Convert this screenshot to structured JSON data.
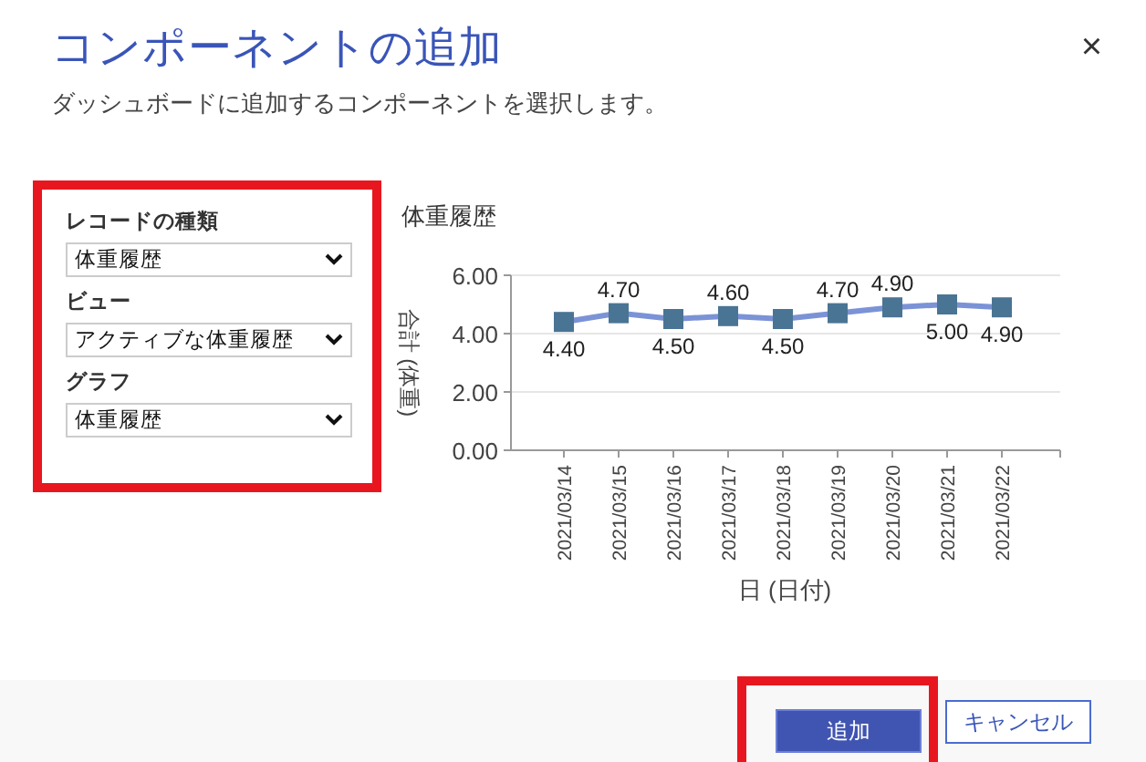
{
  "dialog": {
    "title": "コンポーネントの追加",
    "subtitle": "ダッシュボードに追加するコンポーネントを選択します。",
    "close": "×"
  },
  "fields": [
    {
      "label": "レコードの種類",
      "value": "体重履歴"
    },
    {
      "label": "ビュー",
      "value": "アクティブな体重履歴"
    },
    {
      "label": "グラフ",
      "value": "体重履歴"
    }
  ],
  "chart": {
    "chart_data": {
      "type": "line",
      "title": "体重履歴",
      "xlabel": "日 (日付)",
      "ylabel": "合計 (体重)",
      "categories": [
        "2021/03/14",
        "2021/03/15",
        "2021/03/16",
        "2021/03/17",
        "2021/03/18",
        "2021/03/19",
        "2021/03/20",
        "2021/03/21",
        "2021/03/22"
      ],
      "series": [
        {
          "color": "#7b93d6",
          "marker": "square",
          "values": [
            4.4,
            4.7,
            4.5,
            4.6,
            4.5,
            4.7,
            4.9,
            5.0,
            4.9
          ]
        }
      ],
      "ylim": [
        0,
        6
      ],
      "yticks": [
        {
          "value": 0,
          "label": "0.00"
        },
        {
          "value": 2,
          "label": "2.00"
        },
        {
          "value": 4,
          "label": "4.00"
        },
        {
          "value": 6,
          "label": "6.00"
        }
      ],
      "value_labels": [
        "4.40",
        "4.70",
        "4.50",
        "4.60",
        "4.50",
        "4.70",
        "4.90",
        "5.00",
        "4.90"
      ]
    }
  },
  "buttons": [
    {
      "label": "追加",
      "kind": "primary"
    },
    {
      "label": "キャンセル",
      "kind": "secondary"
    }
  ]
}
